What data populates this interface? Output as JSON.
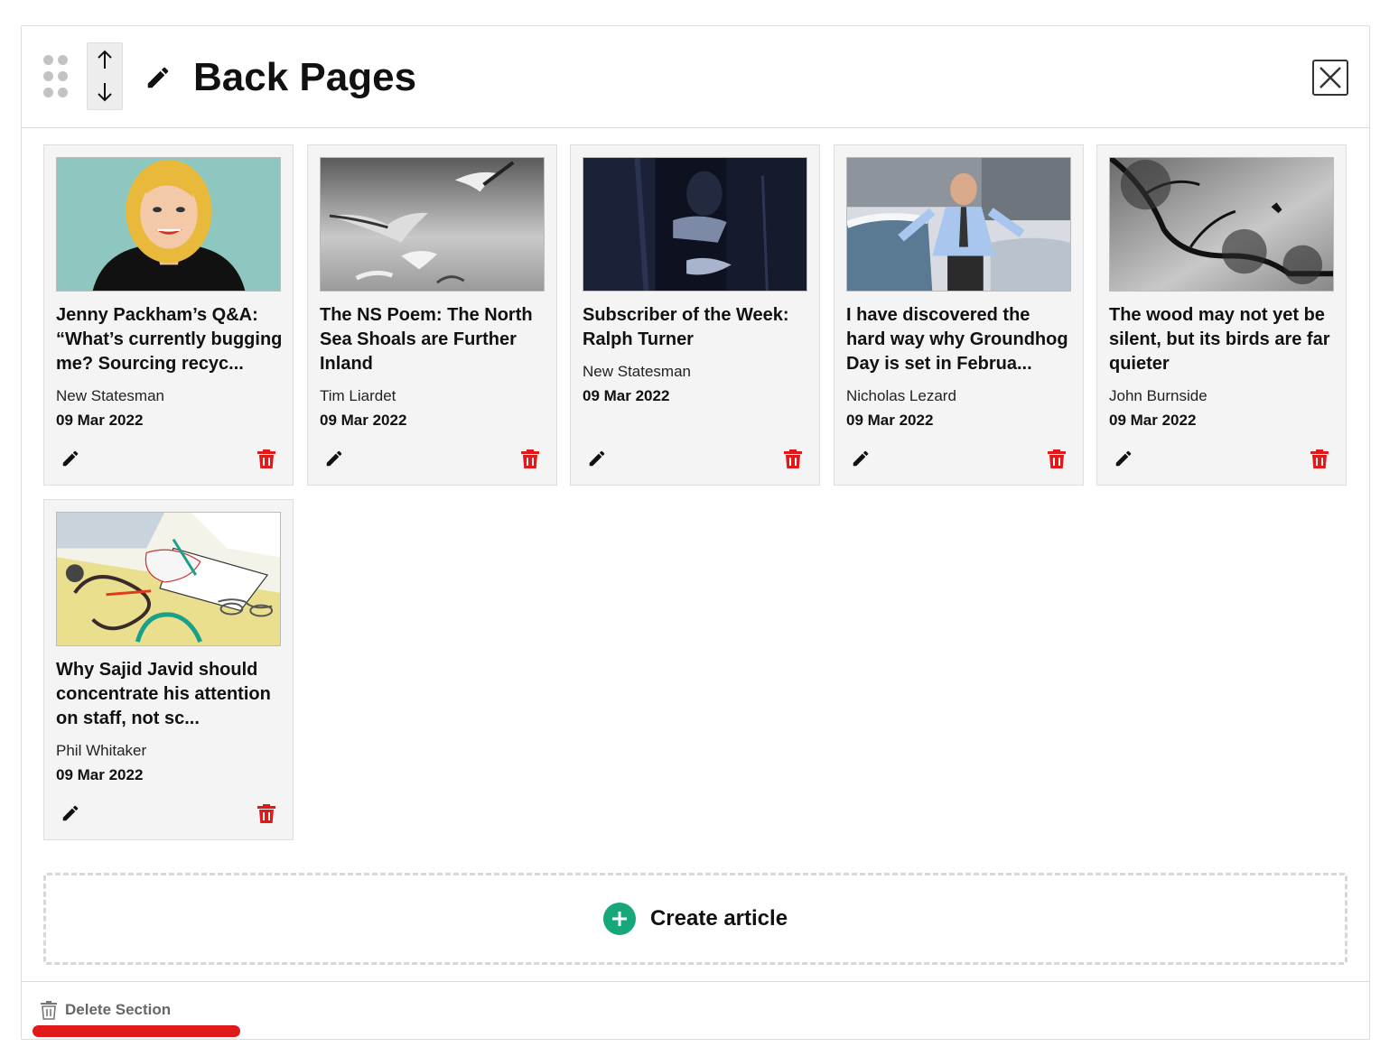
{
  "section": {
    "title": "Back Pages",
    "create_label": "Create article",
    "delete_label": "Delete Section"
  },
  "articles": [
    {
      "title": "Jenny Packham’s Q&A: “What’s currently bugging me? Sourcing recyc...",
      "author": "New Statesman",
      "date": "09 Mar 2022",
      "image": "illustration-portrait"
    },
    {
      "title": "The NS Poem: The North Sea Shoals are Further Inland",
      "author": "Tim Liardet",
      "date": "09 Mar 2022",
      "image": "seagulls-photo"
    },
    {
      "title": "Subscriber of the Week: Ralph Turner",
      "author": "New Statesman",
      "date": "09 Mar 2022",
      "image": "dark-night-photo"
    },
    {
      "title": "I have discovered the hard way why Groundhog Day is set in Februa...",
      "author": "Nicholas Lezard",
      "date": "09 Mar 2022",
      "image": "snow-street-photo"
    },
    {
      "title": "The wood may not yet be silent, but its birds are far quieter",
      "author": "John Burnside",
      "date": "09 Mar 2022",
      "image": "tree-bird-photo"
    },
    {
      "title": "Why Sajid Javid should concentrate his attention on staff, not sc...",
      "author": "Phil Whitaker",
      "date": "09 Mar 2022",
      "image": "desk-illustration"
    }
  ],
  "colors": {
    "accent_green": "#16a77a",
    "delete_red": "#e01a1a",
    "card_bg": "#f4f4f4"
  }
}
